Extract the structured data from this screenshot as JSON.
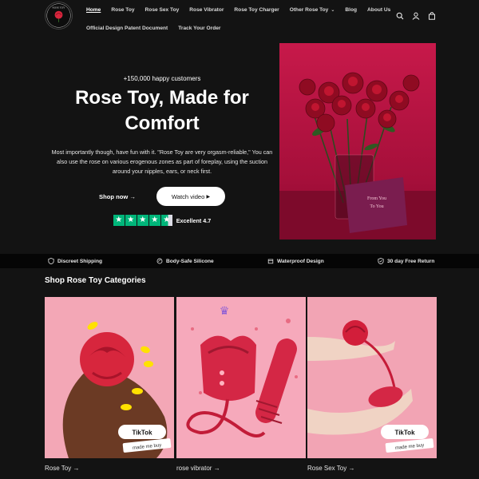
{
  "header": {
    "logo_text": "ROSE TOY",
    "nav_row1": [
      {
        "label": "Home",
        "active": true
      },
      {
        "label": "Rose Toy"
      },
      {
        "label": "Rose Sex Toy"
      },
      {
        "label": "Rose Vibrator"
      },
      {
        "label": "Rose Toy Charger"
      },
      {
        "label": "Other Rose Toy",
        "dropdown": true
      },
      {
        "label": "Blog"
      },
      {
        "label": "About Us"
      }
    ],
    "nav_row2": [
      {
        "label": "Official Design Patent Document"
      },
      {
        "label": "Track Your Order"
      }
    ],
    "icons": [
      "search-icon",
      "account-icon",
      "cart-icon"
    ]
  },
  "hero": {
    "happy_customers": "+150,000 happy customers",
    "title_line1": "Rose Toy, Made for",
    "title_line2": "Comfort",
    "description": "Most importantly though, have fun with it. \"Rose Toy are very orgasm-reliable,\" You can also use the rose on various erogenous zones as part of foreplay, using the suction around your nipples, ears, or neck first.",
    "shop_now": "Shop now",
    "watch_video": "Watch video",
    "rating_text": "Excellent 4.7",
    "rating_value": 4.7,
    "card_text_line1": "From You",
    "card_text_line2": "To You"
  },
  "features": [
    {
      "label": "Discreet Shipping",
      "icon": "shield-icon"
    },
    {
      "label": "Body-Safe Silicone",
      "icon": "leaf-icon"
    },
    {
      "label": "Waterproof Design",
      "icon": "box-icon"
    },
    {
      "label": "30 day Free Return",
      "icon": "check-shield-icon"
    }
  ],
  "categories": {
    "title": "Shop Rose Toy Categories",
    "items": [
      {
        "label": "Rose Toy",
        "badge": "TikTok",
        "sticker": "made me buy"
      },
      {
        "label": "rose vibrator"
      },
      {
        "label": "Rose Sex Toy",
        "badge": "TikTok",
        "sticker": "made me buy"
      }
    ]
  },
  "colors": {
    "background": "#131313",
    "accent_red": "#d7263d",
    "trustpilot_green": "#00b67a",
    "pink": "#f7a8b8"
  }
}
